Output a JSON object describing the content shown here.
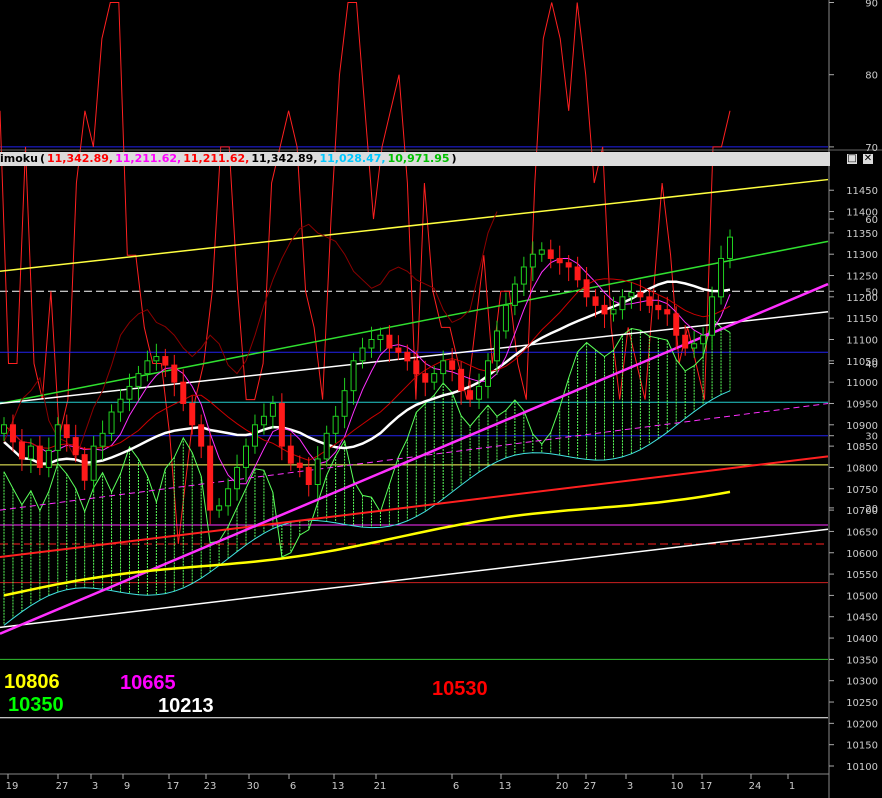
{
  "colors": {
    "background": "#000000",
    "rsi_line": "#ff2020",
    "grid_blue": "#2222ee",
    "bull_candle": "#20d020",
    "bear_candle": "#ff1a1a",
    "cloud": "#5aff5a",
    "tenkan": "#ff30ff",
    "kijun": "#cc0000",
    "chikou": "#8b0000",
    "ma_white": "#ffffff",
    "ma_yellow": "#ffff00",
    "trend_magenta": "#ff30ff",
    "trend_red": "#ff2020",
    "channel_yellow": "#ffff40",
    "channel_green": "#30e030",
    "channel_white": "#ffffff"
  },
  "indicator_title": {
    "name": "imoku",
    "open_paren": "(",
    "close_paren": ")",
    "values": [
      {
        "text": "11,342.89,",
        "color": "#ff0000"
      },
      {
        "text": "11,211.62,",
        "color": "#ff00ff"
      },
      {
        "text": "11,211.62,",
        "color": "#ff0000"
      },
      {
        "text": "11,342.89,",
        "color": "#000000"
      },
      {
        "text": "11,028.47,",
        "color": "#00c8ff"
      },
      {
        "text": "10,971.95",
        "color": "#00c000"
      }
    ]
  },
  "window_buttons": {
    "maximize": "□",
    "close": "✕"
  },
  "levels": [
    {
      "text": "10806",
      "color": "#ffff00"
    },
    {
      "text": "10350",
      "color": "#00ff00"
    },
    {
      "text": "10665",
      "color": "#ff00ff"
    },
    {
      "text": "10213",
      "color": "#ffffff"
    },
    {
      "text": "10530",
      "color": "#ff0000"
    }
  ],
  "chart_data": [
    {
      "type": "line",
      "title": "",
      "ylim": [
        10,
        95
      ],
      "yticks": [
        20,
        30,
        40,
        50,
        60,
        70,
        80,
        90
      ],
      "reference_lines": [
        {
          "value": 70,
          "color": "#2222ee",
          "style": "solid"
        },
        {
          "value": 30,
          "color": "#2222ee",
          "style": "solid"
        },
        {
          "value": 50,
          "color": "#ffffff",
          "style": "dashed"
        },
        {
          "value": 15,
          "color": "#ff2020",
          "style": "dashed"
        }
      ],
      "series": [
        {
          "values": [
            75,
            40,
            40,
            70,
            40,
            35,
            50,
            30,
            35,
            65,
            75,
            70,
            85,
            90,
            90,
            55,
            55,
            45,
            40,
            40,
            30,
            15,
            25,
            35,
            40,
            50,
            70,
            70,
            50,
            35,
            35,
            40,
            65,
            70,
            75,
            70,
            50,
            45,
            35,
            60,
            80,
            90,
            90,
            75,
            60,
            70,
            75,
            80,
            65,
            35,
            65,
            50,
            45,
            45,
            40,
            35,
            45,
            55,
            40,
            50,
            50,
            40,
            35,
            65,
            85,
            90,
            85,
            75,
            90,
            80,
            65,
            70,
            45,
            35,
            45,
            40,
            35,
            50,
            65,
            55,
            40,
            45,
            40,
            35,
            70,
            70,
            75
          ]
        }
      ]
    },
    {
      "type": "candlestick",
      "title": "",
      "ylim": [
        10085,
        11490
      ],
      "yticks": [
        10100,
        10150,
        10200,
        10250,
        10300,
        10350,
        10400,
        10450,
        10500,
        10550,
        10600,
        10650,
        10700,
        10750,
        10800,
        10850,
        10900,
        10950,
        11000,
        11050,
        11100,
        11150,
        11200,
        11250,
        11300,
        11350,
        11400,
        11450
      ],
      "xtick_labels": [
        "19",
        "27",
        "3",
        "9",
        "17",
        "23",
        "30",
        "6",
        "13",
        "21",
        "6",
        "13",
        "20",
        "27",
        "3",
        "10",
        "17",
        "24",
        "1"
      ],
      "horizontal_lines": [
        {
          "value": 11070,
          "color": "#2222ee"
        },
        {
          "value": 10953,
          "color": "#22cccc"
        },
        {
          "value": 10806,
          "color": "#ffff60"
        },
        {
          "value": 10665,
          "color": "#ff30ff"
        },
        {
          "value": 10530,
          "color": "#cc2020"
        },
        {
          "value": 10350,
          "color": "#30c030"
        },
        {
          "value": 10213,
          "color": "#ffffff"
        }
      ],
      "close": [
        10900,
        10860,
        10820,
        10850,
        10800,
        10840,
        10900,
        10870,
        10830,
        10770,
        10850,
        10880,
        10930,
        10960,
        10990,
        11020,
        11050,
        11060,
        11040,
        11000,
        10950,
        10900,
        10850,
        10700,
        10710,
        10750,
        10800,
        10850,
        10900,
        10920,
        10950,
        10850,
        10810,
        10800,
        10760,
        10820,
        10880,
        10920,
        10980,
        11050,
        11080,
        11100,
        11110,
        11080,
        11070,
        11050,
        11020,
        11000,
        11020,
        11050,
        11030,
        10980,
        10960,
        10990,
        11050,
        11120,
        11180,
        11230,
        11270,
        11300,
        11310,
        11290,
        11280,
        11270,
        11240,
        11200,
        11180,
        11160,
        11170,
        11200,
        11210,
        11200,
        11180,
        11170,
        11160,
        11110,
        11080,
        11090,
        11110,
        11200,
        11290,
        11340
      ]
    }
  ]
}
